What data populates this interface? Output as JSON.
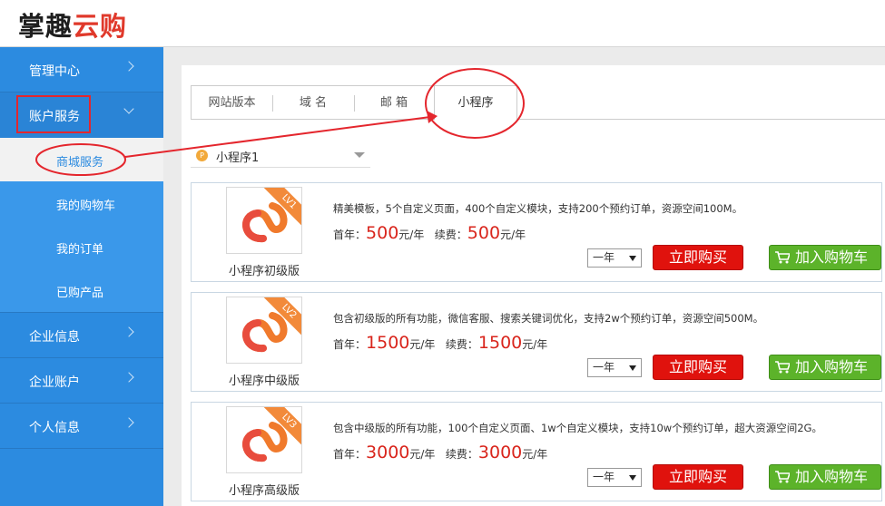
{
  "header": {
    "logo_part1": "掌趣",
    "logo_cloud": "云",
    "logo_last": "购"
  },
  "sidebar": {
    "items": [
      {
        "label": "管理中心"
      },
      {
        "label": "账户服务"
      },
      {
        "label": "企业信息"
      },
      {
        "label": "企业账户"
      },
      {
        "label": "个人信息"
      }
    ],
    "subitems": [
      {
        "label": "商城服务"
      },
      {
        "label": "我的购物车"
      },
      {
        "label": "我的订单"
      },
      {
        "label": "已购产品"
      }
    ]
  },
  "tabs": [
    {
      "label": "网站版本"
    },
    {
      "label": "域  名"
    },
    {
      "label": "邮  箱"
    },
    {
      "label": "小程序"
    }
  ],
  "selector": {
    "value": "小程序1",
    "icon_glyph": "P"
  },
  "colors": {
    "accent": "#2c8be0",
    "buy": "#e0120d",
    "cart": "#5cb32a",
    "price": "#d9251c",
    "annotation": "#e4262d"
  },
  "products": [
    {
      "name": "小程序初级版",
      "level": "LV1",
      "desc": "精美模板，5个自定义页面，400个自定义模块，支持200个预约订单，资源空间100M。",
      "first_label": "首年：",
      "first_price": "500",
      "renew_label": "续费：",
      "renew_price": "500",
      "unit": "元/年",
      "period": "一年",
      "buy_label": "立即购买",
      "cart_label": "加入购物车"
    },
    {
      "name": "小程序中级版",
      "level": "LV2",
      "desc": "包含初级版的所有功能，微信客服、搜索关键词优化，支持2w个预约订单，资源空间500M。",
      "first_label": "首年：",
      "first_price": "1500",
      "renew_label": "续费：",
      "renew_price": "1500",
      "unit": "元/年",
      "period": "一年",
      "buy_label": "立即购买",
      "cart_label": "加入购物车"
    },
    {
      "name": "小程序高级版",
      "level": "LV3",
      "desc": "包含中级版的所有功能，100个自定义页面、1w个自定义模块，支持10w个预约订单，超大资源空间2G。",
      "first_label": "首年：",
      "first_price": "3000",
      "renew_label": "续费：",
      "renew_price": "3000",
      "unit": "元/年",
      "period": "一年",
      "buy_label": "立即购买",
      "cart_label": "加入购物车"
    }
  ]
}
